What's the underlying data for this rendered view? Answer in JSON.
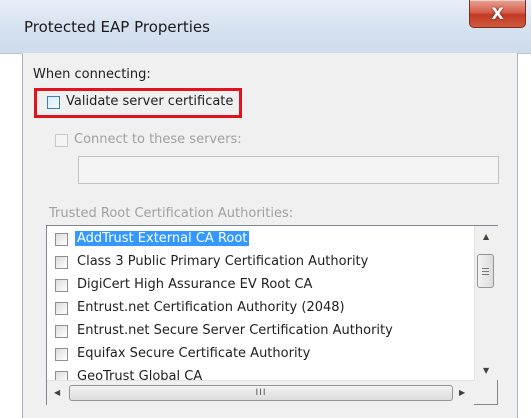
{
  "window": {
    "title": "Protected EAP Properties",
    "close_glyph": "X"
  },
  "connecting": {
    "label": "When connecting:",
    "validate_certificate": {
      "label": "Validate server certificate",
      "checked": false
    },
    "connect_to_servers": {
      "label": "Connect to these servers:",
      "checked": false,
      "enabled": false
    },
    "servers_input_value": ""
  },
  "trusted_roots": {
    "label": "Trusted Root Certification Authorities:",
    "items": [
      {
        "label": "AddTrust External CA Root",
        "checked": false,
        "selected": true
      },
      {
        "label": "Class 3 Public Primary Certification Authority",
        "checked": false,
        "selected": false
      },
      {
        "label": "DigiCert High Assurance EV Root CA",
        "checked": false,
        "selected": false
      },
      {
        "label": "Entrust.net Certification Authority (2048)",
        "checked": false,
        "selected": false
      },
      {
        "label": "Entrust.net Secure Server Certification Authority",
        "checked": false,
        "selected": false
      },
      {
        "label": "Equifax Secure Certificate Authority",
        "checked": false,
        "selected": false
      },
      {
        "label": "GeoTrust Global CA",
        "checked": false,
        "selected": false
      }
    ]
  },
  "scrollbars": {
    "up_glyph": "▲",
    "down_glyph": "▼",
    "left_glyph": "◀",
    "right_glyph": "▶",
    "h_thumb_grip": "III"
  },
  "colors": {
    "highlight_border": "#e0141e",
    "selection": "#3399ff",
    "close_button": "#c23a22"
  }
}
